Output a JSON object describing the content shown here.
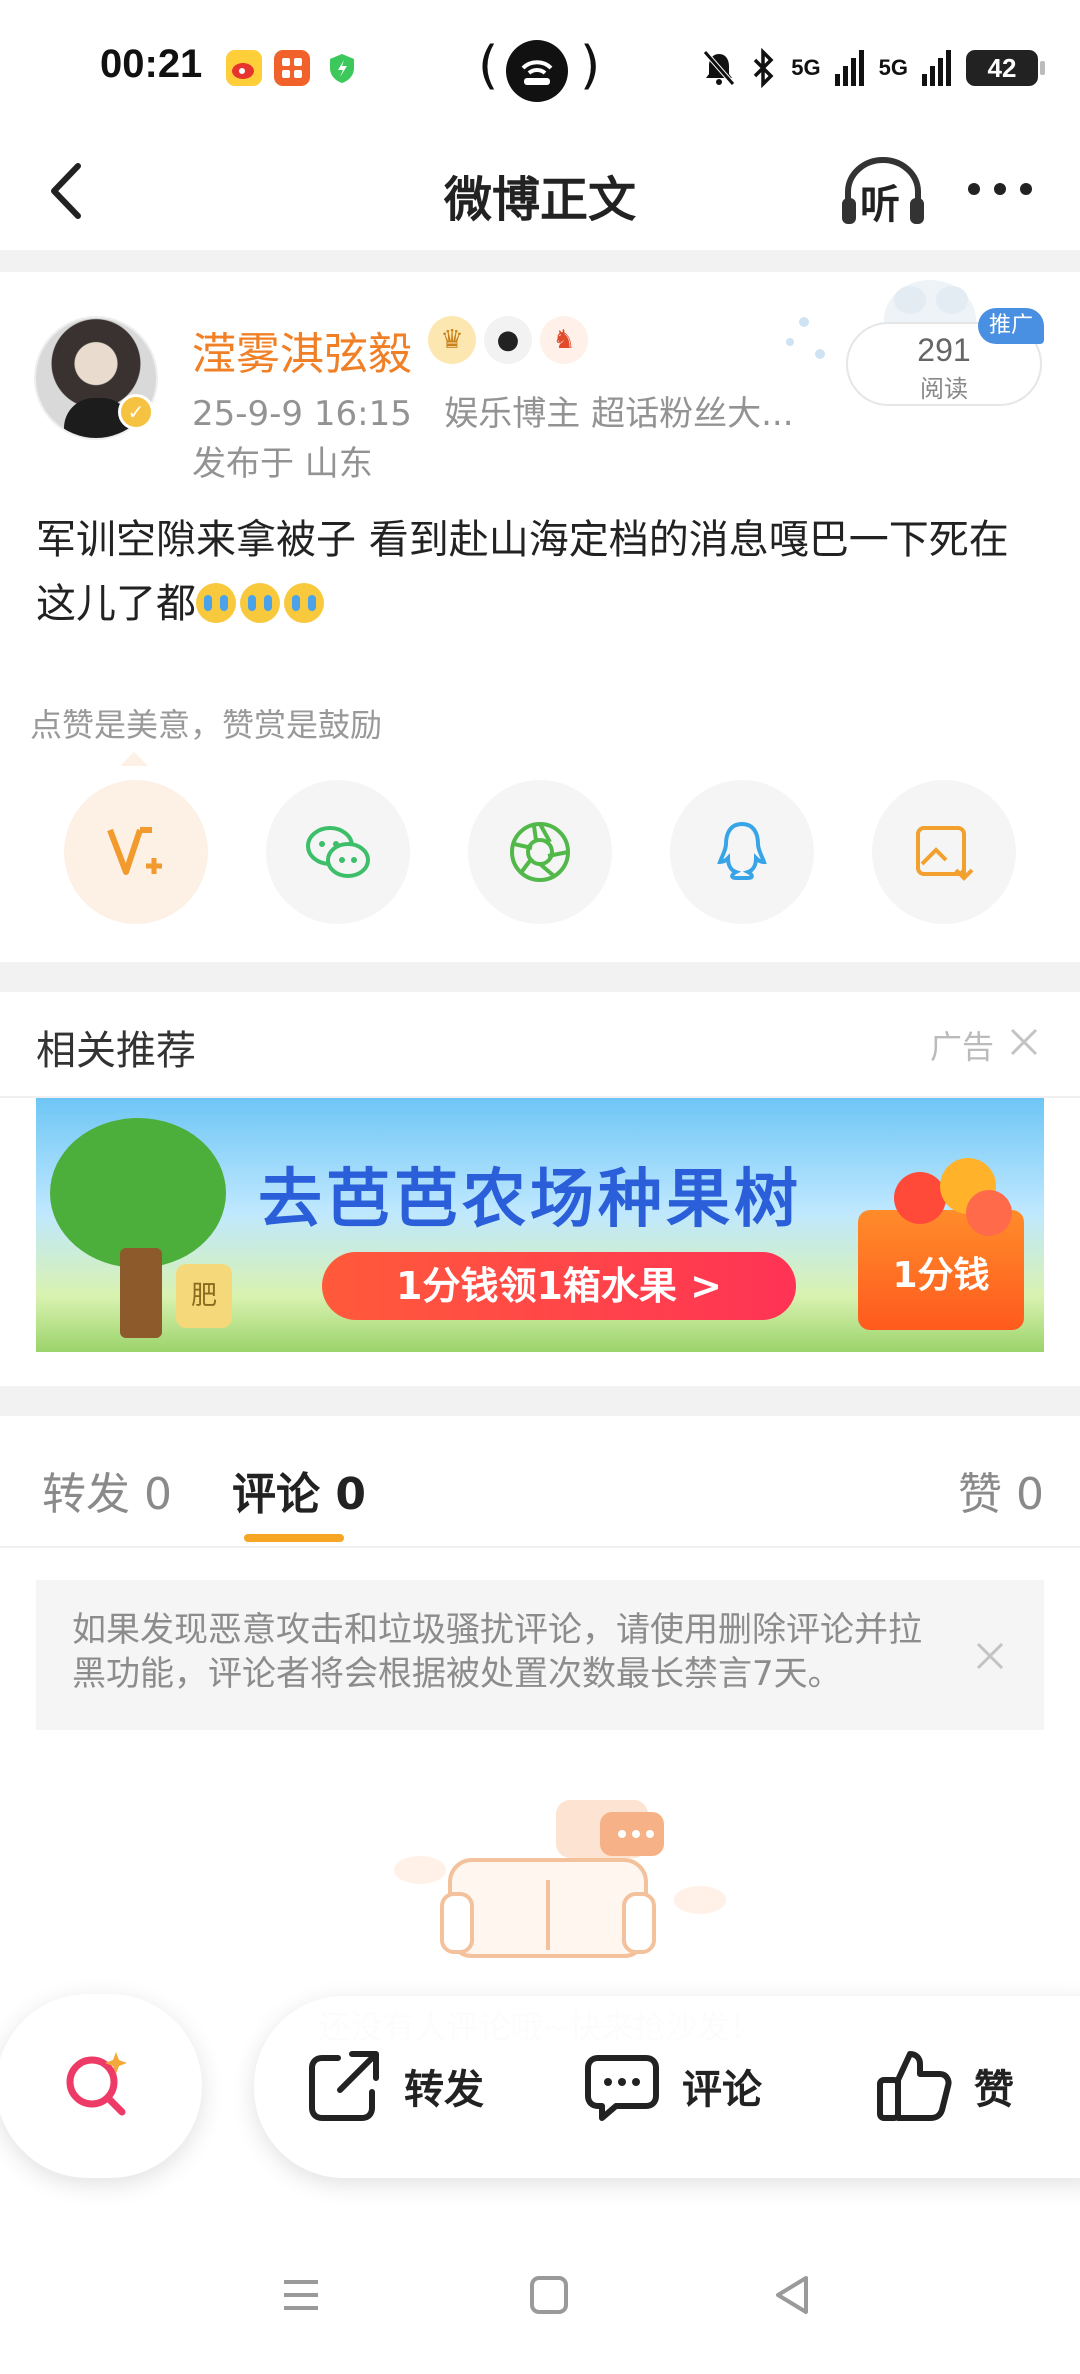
{
  "status_bar": {
    "time": "00:21",
    "signal_1": "5G",
    "signal_2": "5G",
    "battery": "42",
    "icons": [
      "weibo-app-icon",
      "app-icon",
      "shield-icon",
      "wireless-icon",
      "mute-icon",
      "bluetooth-icon"
    ]
  },
  "nav": {
    "title": "微博正文",
    "listen_label": "听"
  },
  "post": {
    "username": "滢雾淇弦毅",
    "time": "25-9-9 16:15",
    "source": "娱乐博主 超话粉丝大...",
    "location": "发布于 山东",
    "reads_count": "291",
    "reads_label": "阅读",
    "promo_tag": "推广",
    "text": "军训空隙来拿被子 看到赴山海定档的消息嘎巴一下死在这儿了都",
    "emoji_count": 3,
    "colors": {
      "username": "#f07f25",
      "accent": "#f6a623"
    }
  },
  "reward": {
    "tip": "点赞是美意，赞赏是鼓励",
    "share_buttons": [
      "reward-icon",
      "wechat-icon",
      "moments-icon",
      "qq-icon",
      "save-image-icon"
    ]
  },
  "related": {
    "title": "相关推荐",
    "ad_label": "广告",
    "banner_title": "去芭芭农场种果树",
    "banner_button": "1分钱领1箱水果 >",
    "banner_price": "1分钱",
    "banner_jar_label": "肥"
  },
  "tabs": {
    "repost": "转发 0",
    "comment": "评论 0",
    "like": "赞 0"
  },
  "notice": {
    "text": "如果发现恶意攻击和垃圾骚扰评论，请使用删除评论并拉黑功能，评论者将会根据被处置次数最长禁言7天。"
  },
  "empty": {
    "text": "还没有人评论哦~快来抢沙发！"
  },
  "actions": {
    "repost": "转发",
    "comment": "评论",
    "like": "赞"
  }
}
